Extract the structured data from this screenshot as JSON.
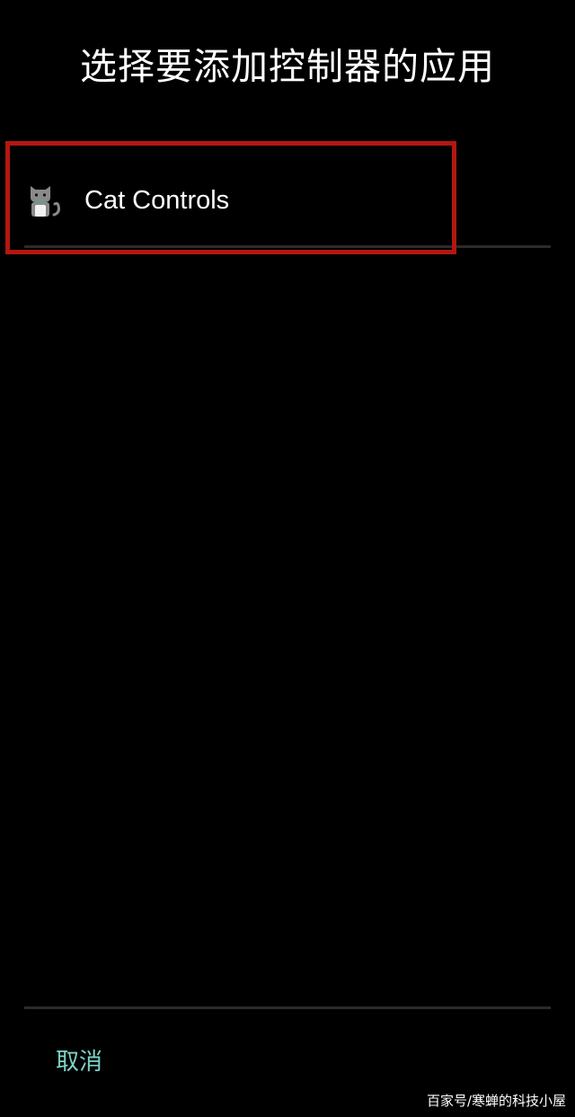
{
  "header": {
    "title": "选择要添加控制器的应用"
  },
  "apps": [
    {
      "label": "Cat Controls",
      "icon": "cat-icon"
    }
  ],
  "footer": {
    "cancel_label": "取消"
  },
  "watermark": "百家号/寒蝉的科技小屋",
  "colors": {
    "background": "#000000",
    "accent": "#7ed3c6",
    "highlight": "#b3170f",
    "divider": "#2b2b2e"
  }
}
